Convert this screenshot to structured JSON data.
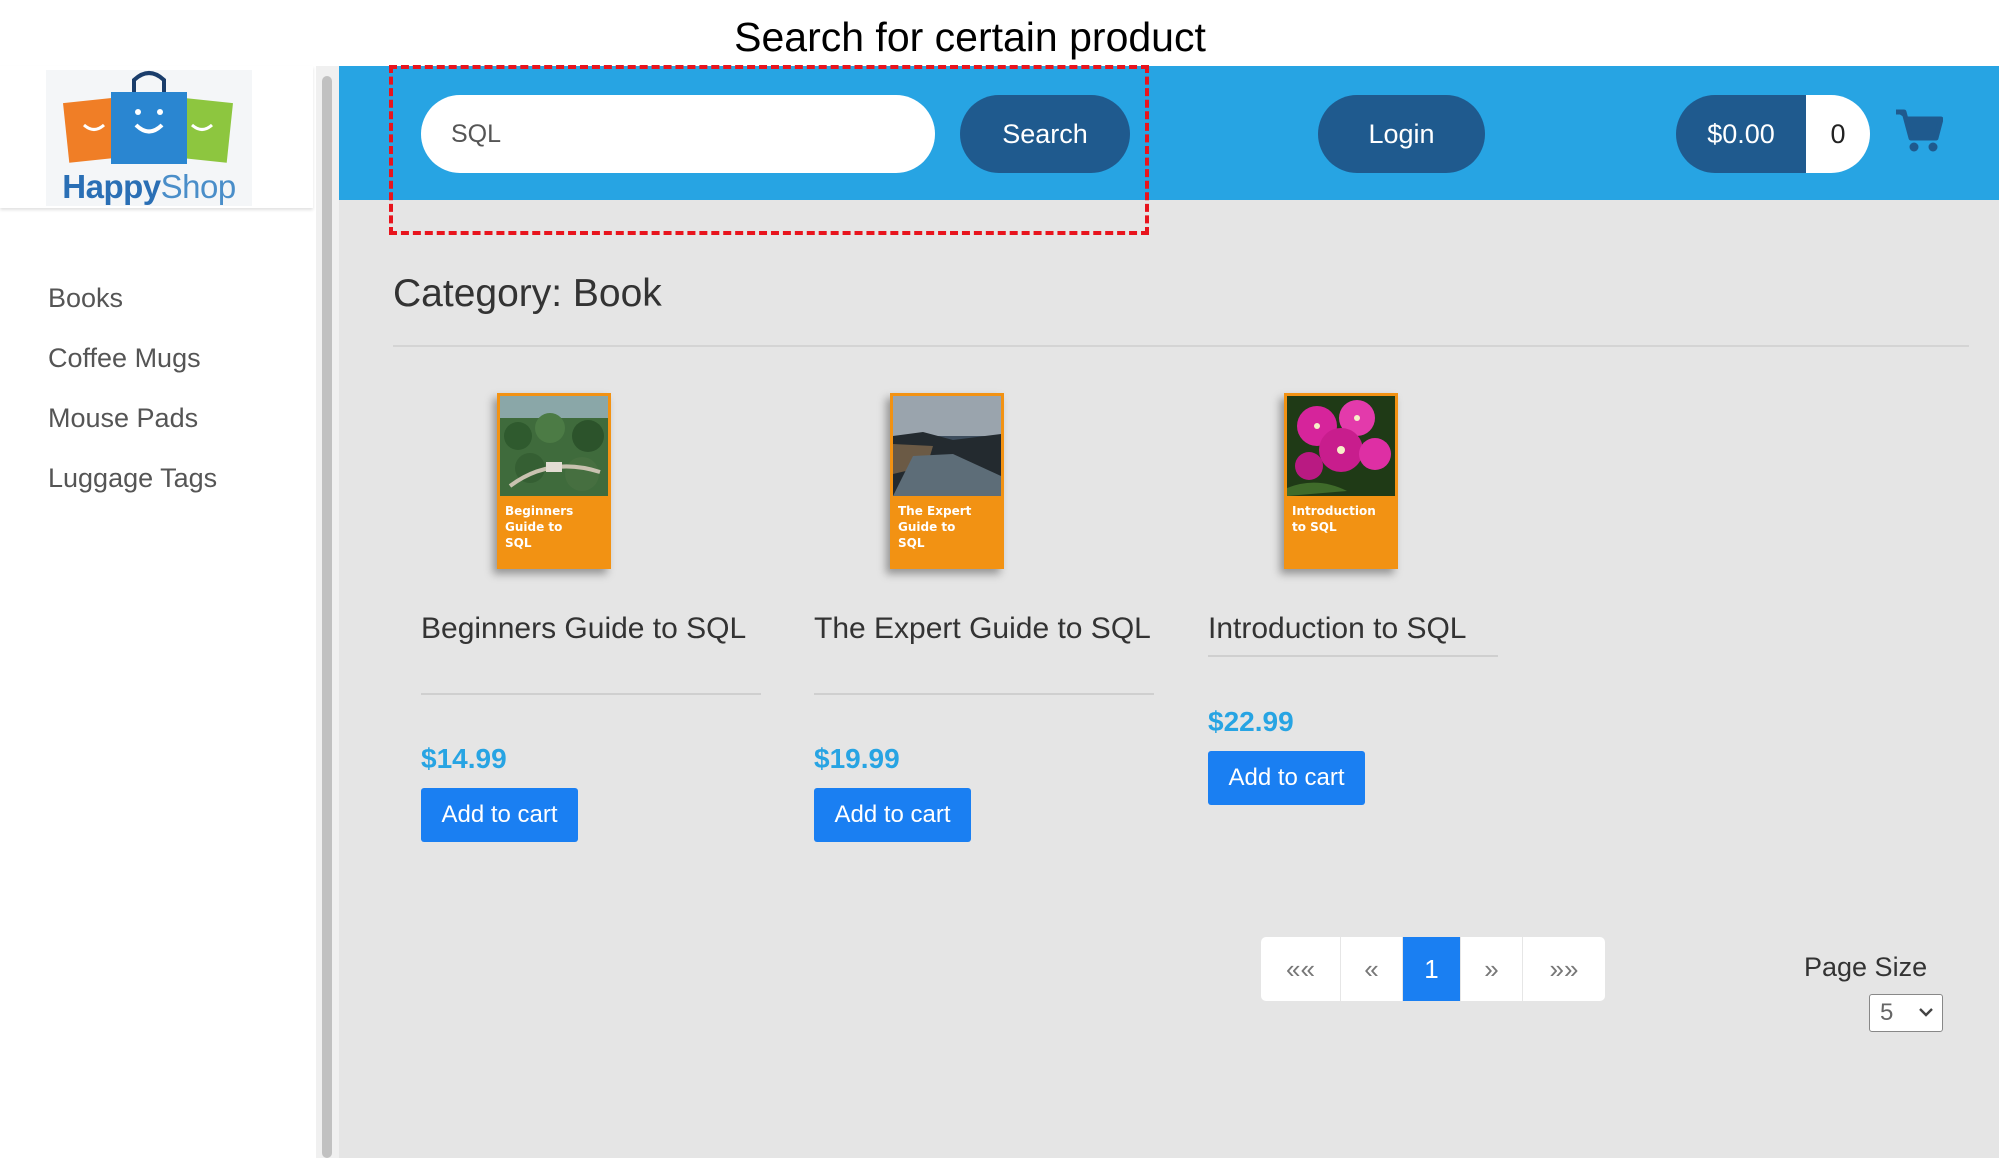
{
  "annotation": {
    "caption": "Search for certain product"
  },
  "brand": {
    "logo_word_1": "Happy",
    "logo_word_2": "Shop"
  },
  "sidebar": {
    "items": [
      {
        "label": "Books"
      },
      {
        "label": "Coffee Mugs"
      },
      {
        "label": "Mouse Pads"
      },
      {
        "label": "Luggage Tags"
      }
    ]
  },
  "header": {
    "search_value": "SQL",
    "search_label": "Search",
    "login_label": "Login",
    "cart_total": "$0.00",
    "cart_count": "0",
    "cart_icon": "shopping-cart-icon"
  },
  "category_title": "Category: Book",
  "products": [
    {
      "name": "Beginners Guide to SQL",
      "price": "$14.99",
      "add_label": "Add to cart",
      "cover_title": "Beginners Guide to SQL"
    },
    {
      "name": "The Expert Guide to SQL",
      "price": "$19.99",
      "add_label": "Add to cart",
      "cover_title": "The Expert Guide to SQL"
    },
    {
      "name": "Introduction to SQL",
      "price": "$22.99",
      "add_label": "Add to cart",
      "cover_title": "Introduction to SQL"
    }
  ],
  "pagination": {
    "first": "««",
    "prev": "«",
    "current": "1",
    "next": "»",
    "last": "»»"
  },
  "page_size": {
    "label": "Page Size",
    "value": "5"
  },
  "colors": {
    "header_blue": "#27a4e3",
    "dark_pill": "#1f5a8e",
    "button_blue": "#1a7ff2",
    "annotation_red": "#e8141d"
  }
}
